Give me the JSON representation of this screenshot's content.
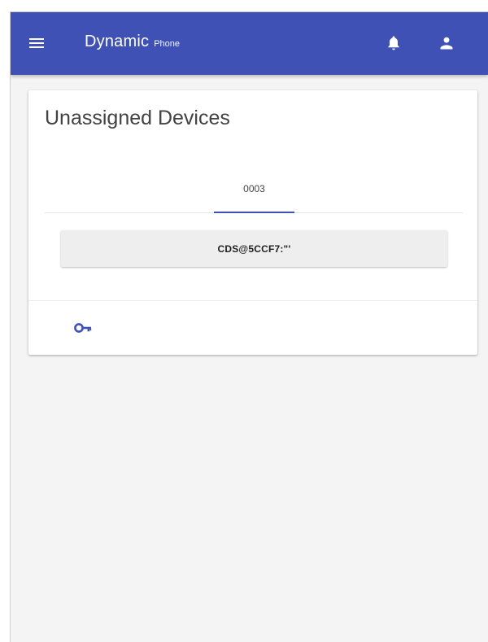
{
  "app_bar": {
    "title": "Dynamic",
    "subtitle": "Phone",
    "background": "#3f51b5",
    "icons": {
      "menu": "menu-icon",
      "notifications": "bell-icon",
      "account": "user-icon"
    }
  },
  "card": {
    "title": "Unassigned Devices",
    "tabs": [
      {
        "label": "0003",
        "selected": true
      }
    ],
    "device_button": "CDS@5CCF7:\"'",
    "footer_icon": "key-icon",
    "accent": "#3f51b5"
  }
}
